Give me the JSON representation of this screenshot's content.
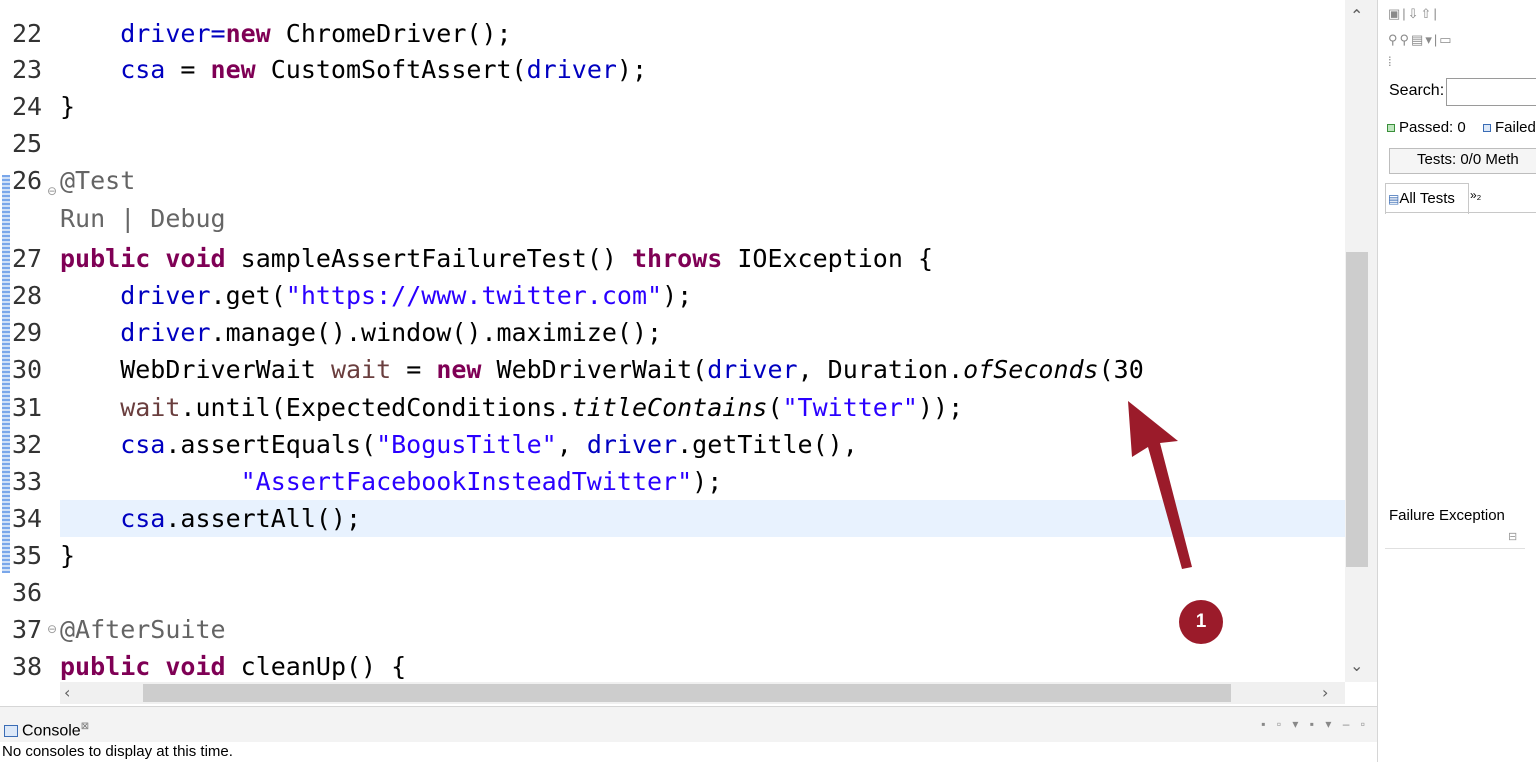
{
  "editor": {
    "lines": [
      {
        "num": "22",
        "segments": [
          {
            "t": "    driver=",
            "c": "field"
          },
          {
            "t": "new",
            "c": "kw"
          },
          {
            "t": " ChromeDriver();",
            "c": ""
          }
        ]
      },
      {
        "num": "23",
        "segments": [
          {
            "t": "    csa",
            "c": "field"
          },
          {
            "t": " = ",
            "c": ""
          },
          {
            "t": "new",
            "c": "kw"
          },
          {
            "t": " CustomSoftAssert(",
            "c": ""
          },
          {
            "t": "driver",
            "c": "field"
          },
          {
            "t": ");",
            "c": ""
          }
        ]
      },
      {
        "num": "24",
        "segments": [
          {
            "t": "}",
            "c": ""
          }
        ]
      },
      {
        "num": "25",
        "segments": []
      },
      {
        "num": "26",
        "segments": [
          {
            "t": "@Test",
            "c": "ann"
          }
        ]
      },
      {
        "num": "27",
        "segments": [
          {
            "t": "public",
            "c": "kw"
          },
          {
            "t": " ",
            "c": ""
          },
          {
            "t": "void",
            "c": "kw"
          },
          {
            "t": " sampleAssertFailureTest() ",
            "c": ""
          },
          {
            "t": "throws",
            "c": "kw"
          },
          {
            "t": " IOException {",
            "c": ""
          }
        ]
      },
      {
        "num": "28",
        "segments": [
          {
            "t": "    driver",
            "c": "field"
          },
          {
            "t": ".get(",
            "c": ""
          },
          {
            "t": "\"https://www.twitter.com\"",
            "c": "str"
          },
          {
            "t": ");",
            "c": ""
          }
        ]
      },
      {
        "num": "29",
        "segments": [
          {
            "t": "    driver",
            "c": "field"
          },
          {
            "t": ".manage().window().maximize();",
            "c": ""
          }
        ]
      },
      {
        "num": "30",
        "segments": [
          {
            "t": "    WebDriverWait ",
            "c": ""
          },
          {
            "t": "wait",
            "c": "var"
          },
          {
            "t": " = ",
            "c": ""
          },
          {
            "t": "new",
            "c": "kw"
          },
          {
            "t": " WebDriverWait(",
            "c": ""
          },
          {
            "t": "driver",
            "c": "field"
          },
          {
            "t": ", Duration.",
            "c": ""
          },
          {
            "t": "ofSeconds",
            "c": "ital"
          },
          {
            "t": "(30",
            "c": ""
          }
        ]
      },
      {
        "num": "31",
        "segments": [
          {
            "t": "    wait",
            "c": "var"
          },
          {
            "t": ".until(ExpectedConditions.",
            "c": ""
          },
          {
            "t": "titleContains",
            "c": "ital"
          },
          {
            "t": "(",
            "c": ""
          },
          {
            "t": "\"Twitter\"",
            "c": "str"
          },
          {
            "t": "));",
            "c": ""
          }
        ]
      },
      {
        "num": "32",
        "segments": [
          {
            "t": "    csa",
            "c": "field"
          },
          {
            "t": ".assertEquals(",
            "c": ""
          },
          {
            "t": "\"BogusTitle\"",
            "c": "str"
          },
          {
            "t": ", ",
            "c": ""
          },
          {
            "t": "driver",
            "c": "field"
          },
          {
            "t": ".getTitle(),",
            "c": ""
          }
        ]
      },
      {
        "num": "33",
        "segments": [
          {
            "t": "            ",
            "c": ""
          },
          {
            "t": "\"AssertFacebookInsteadTwitter\"",
            "c": "str"
          },
          {
            "t": ");",
            "c": ""
          }
        ]
      },
      {
        "num": "34",
        "segments": [
          {
            "t": "    csa",
            "c": "field"
          },
          {
            "t": ".assertAll();",
            "c": ""
          }
        ]
      },
      {
        "num": "35",
        "segments": [
          {
            "t": "}",
            "c": ""
          }
        ]
      },
      {
        "num": "36",
        "segments": []
      },
      {
        "num": "37",
        "segments": [
          {
            "t": "@AfterSuite",
            "c": "ann"
          }
        ]
      },
      {
        "num": "38",
        "segments": [
          {
            "t": "public",
            "c": "kw"
          },
          {
            "t": " ",
            "c": ""
          },
          {
            "t": "void",
            "c": "kw"
          },
          {
            "t": " cleanUp() {",
            "c": ""
          }
        ]
      }
    ],
    "codelens": "Run | Debug"
  },
  "console": {
    "tab_label": "Console",
    "message": "No consoles to display at this time."
  },
  "testng": {
    "search_label": "Search:",
    "search_value": "",
    "passed_label": "Passed: 0",
    "failed_label": "Failed",
    "tests_label": "Tests: 0/0  Meth",
    "tab_all_tests": "All Tests",
    "tab_more": "»₂",
    "failure_exception": "Failure Exception"
  },
  "callout": {
    "number": "1"
  },
  "colors": {
    "keyword": "#7f0055",
    "string": "#2a00ff",
    "field": "#0000c0",
    "callout": "#9b1b2a",
    "highlight": "#e8f2fe"
  }
}
